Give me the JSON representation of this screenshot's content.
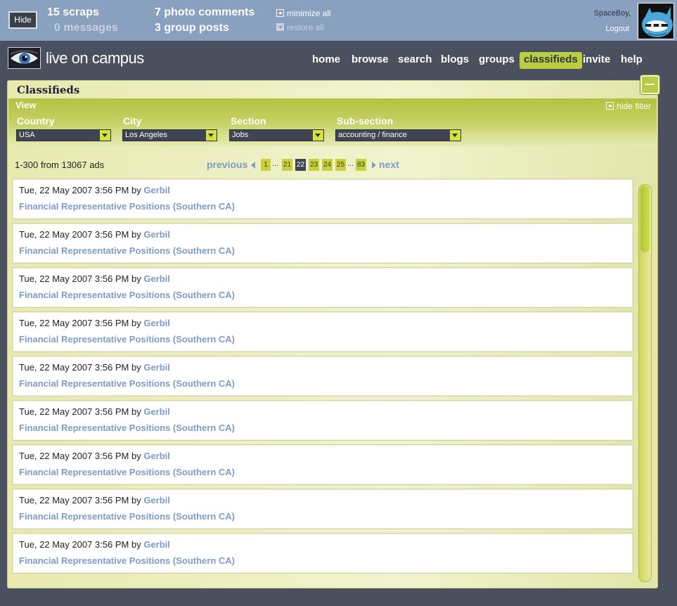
{
  "topbar": {
    "hide_label": "Hide",
    "scraps": {
      "count": "15",
      "label": "scraps"
    },
    "messages": {
      "count": "0",
      "label": "messages"
    },
    "photo_comments": {
      "count": "7",
      "label": "photo comments"
    },
    "group_posts": {
      "count": "3",
      "label": "group posts"
    },
    "minimize_all": "minimize all",
    "restore_all": "restore all",
    "user_name": "SpaceBoy,",
    "logout": "Logout"
  },
  "header": {
    "logo_text": "live on campus",
    "nav": [
      {
        "label": "home",
        "active": false
      },
      {
        "label": "browse",
        "active": false
      },
      {
        "label": "search",
        "active": false
      },
      {
        "label": "blogs",
        "active": false
      },
      {
        "label": "groups",
        "active": false
      },
      {
        "label": "classifieds",
        "active": true
      },
      {
        "label": "invite",
        "active": false
      },
      {
        "label": "help",
        "active": false
      }
    ]
  },
  "panel": {
    "title": "Classifieds",
    "filter": {
      "view_label": "View",
      "hide_filter": "hide filter",
      "country": {
        "label": "Country",
        "value": "USA"
      },
      "city": {
        "label": "City",
        "value": "Los Angeles"
      },
      "section": {
        "label": "Section",
        "value": "Jobs"
      },
      "subsection": {
        "label": "Sub-section",
        "value": "accounting / finance"
      }
    },
    "result_count": "1-300 from 13067 ads",
    "pager": {
      "previous": "previous",
      "next": "next",
      "pages": [
        "1",
        "21",
        "22",
        "23",
        "24",
        "25",
        "83"
      ],
      "current": "22",
      "ellipsis": "..."
    },
    "ads": [
      {
        "date": "Tue, 22 May 2007 3:56 PM",
        "by": "by",
        "author": "Gerbil",
        "title": "Financial Representative Positions (Southern CA)"
      },
      {
        "date": "Tue, 22 May 2007 3:56 PM",
        "by": "by",
        "author": "Gerbil",
        "title": "Financial Representative Positions (Southern CA)"
      },
      {
        "date": "Tue, 22 May 2007 3:56 PM",
        "by": "by",
        "author": "Gerbil",
        "title": "Financial Representative Positions (Southern CA)"
      },
      {
        "date": "Tue, 22 May 2007 3:56 PM",
        "by": "by",
        "author": "Gerbil",
        "title": "Financial Representative Positions (Southern CA)"
      },
      {
        "date": "Tue, 22 May 2007 3:56 PM",
        "by": "by",
        "author": "Gerbil",
        "title": "Financial Representative Positions (Southern CA)"
      },
      {
        "date": "Tue, 22 May 2007 3:56 PM",
        "by": "by",
        "author": "Gerbil",
        "title": "Financial Representative Positions (Southern CA)"
      },
      {
        "date": "Tue, 22 May 2007 3:56 PM",
        "by": "by",
        "author": "Gerbil",
        "title": "Financial Representative Positions (Southern CA)"
      },
      {
        "date": "Tue, 22 May 2007 3:56 PM",
        "by": "by",
        "author": "Gerbil",
        "title": "Financial Representative Positions (Southern CA)"
      },
      {
        "date": "Tue, 22 May 2007 3:56 PM",
        "by": "by",
        "author": "Gerbil",
        "title": "Financial Representative Positions (Southern CA)"
      }
    ]
  },
  "colors": {
    "topbar": "#8aa0bf",
    "background": "#4a505e",
    "accent": "#b9cf3f",
    "link": "#7e9bc9"
  },
  "icons": {
    "minimize": "minimize-all-icon",
    "restore": "restore-all-icon",
    "hide_filter": "hide-filter-icon",
    "panel_minimize": "panel-minimize-icon",
    "dropdown": "chevron-down-icon",
    "logo": "eye-logo-icon",
    "avatar": "ninja-avatar"
  }
}
